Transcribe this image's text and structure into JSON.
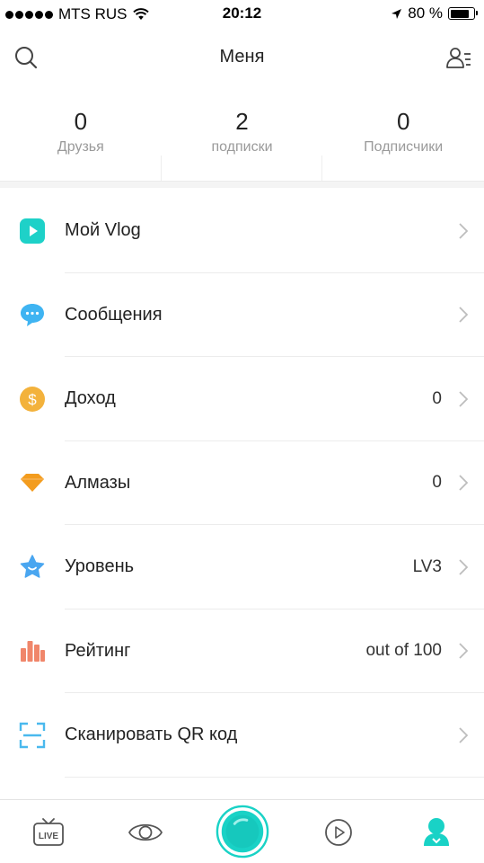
{
  "status_bar": {
    "carrier": "MTS RUS",
    "time": "20:12",
    "battery": "80 %",
    "battery_level": 0.8
  },
  "header": {
    "title": "Меня",
    "search_icon": "search-icon",
    "contacts_icon": "contacts-list-icon"
  },
  "stats": [
    {
      "value": "0",
      "label": "Друзья"
    },
    {
      "value": "2",
      "label": "подписки"
    },
    {
      "value": "0",
      "label": "Подписчики"
    }
  ],
  "menu": [
    {
      "label": "Мой Vlog",
      "value": "",
      "icon": "vlog-play-icon",
      "color": "#1ed1c8"
    },
    {
      "label": "Сообщения",
      "value": "",
      "icon": "message-bubble-icon",
      "color": "#3fb4f2"
    },
    {
      "label": "Доход",
      "value": "0",
      "icon": "dollar-coin-icon",
      "color": "#f3b23c"
    },
    {
      "label": "Алмазы",
      "value": "0",
      "icon": "diamond-icon",
      "color": "#f39c1e"
    },
    {
      "label": "Уровень",
      "value": "LV3",
      "icon": "star-level-icon",
      "color": "#4aa6f0"
    },
    {
      "label": "Рейтинг",
      "value": "out of 100",
      "icon": "ranking-bars-icon",
      "color": "#f0866a"
    },
    {
      "label": "Сканировать QR код",
      "value": "",
      "icon": "qr-scan-icon",
      "color": "#4ab9ee"
    }
  ],
  "tabbar": {
    "live_label": "LIVE",
    "tabs": [
      "live-tv-icon",
      "eye-icon",
      "camera-record-icon",
      "video-play-icon",
      "profile-icon"
    ],
    "accent": "#19d2c6"
  }
}
